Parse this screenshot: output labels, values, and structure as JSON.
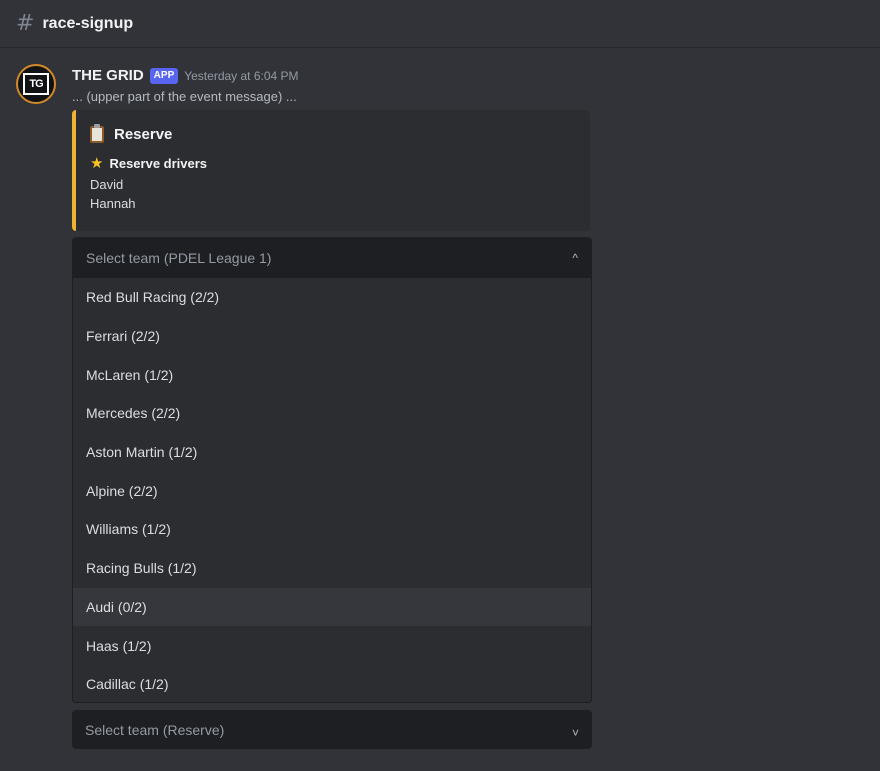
{
  "channel": {
    "icon": "hash-icon",
    "name": "race-signup"
  },
  "message": {
    "author": "THE GRID",
    "avatar_text": "TG",
    "badge": "APP",
    "timestamp": "Yesterday at 6:04 PM",
    "context": "... (upper part of the event message) ..."
  },
  "embed": {
    "accent_color": "#f0b232",
    "title_icon": "clipboard-icon",
    "title": "Reserve",
    "field_icon": "star-icon",
    "field_name": "Reserve drivers",
    "values": [
      "David",
      "Hannah"
    ]
  },
  "team_select": {
    "placeholder": "Select team (PDEL League 1)",
    "state": "open",
    "hovered_index": 8,
    "options": [
      "Red Bull Racing (2/2)",
      "Ferrari (2/2)",
      "McLaren (1/2)",
      "Mercedes (2/2)",
      "Aston Martin (1/2)",
      "Alpine (2/2)",
      "Williams (1/2)",
      "Racing Bulls (1/2)",
      "Audi (0/2)",
      "Haas (1/2)",
      "Cadillac (1/2)"
    ]
  },
  "reserve_select": {
    "placeholder": "Select team (Reserve)",
    "state": "closed"
  },
  "colors": {
    "background": "#313338",
    "embed_bg": "#2b2d31",
    "select_bg": "#1e1f22",
    "badge": "#5865f2"
  }
}
